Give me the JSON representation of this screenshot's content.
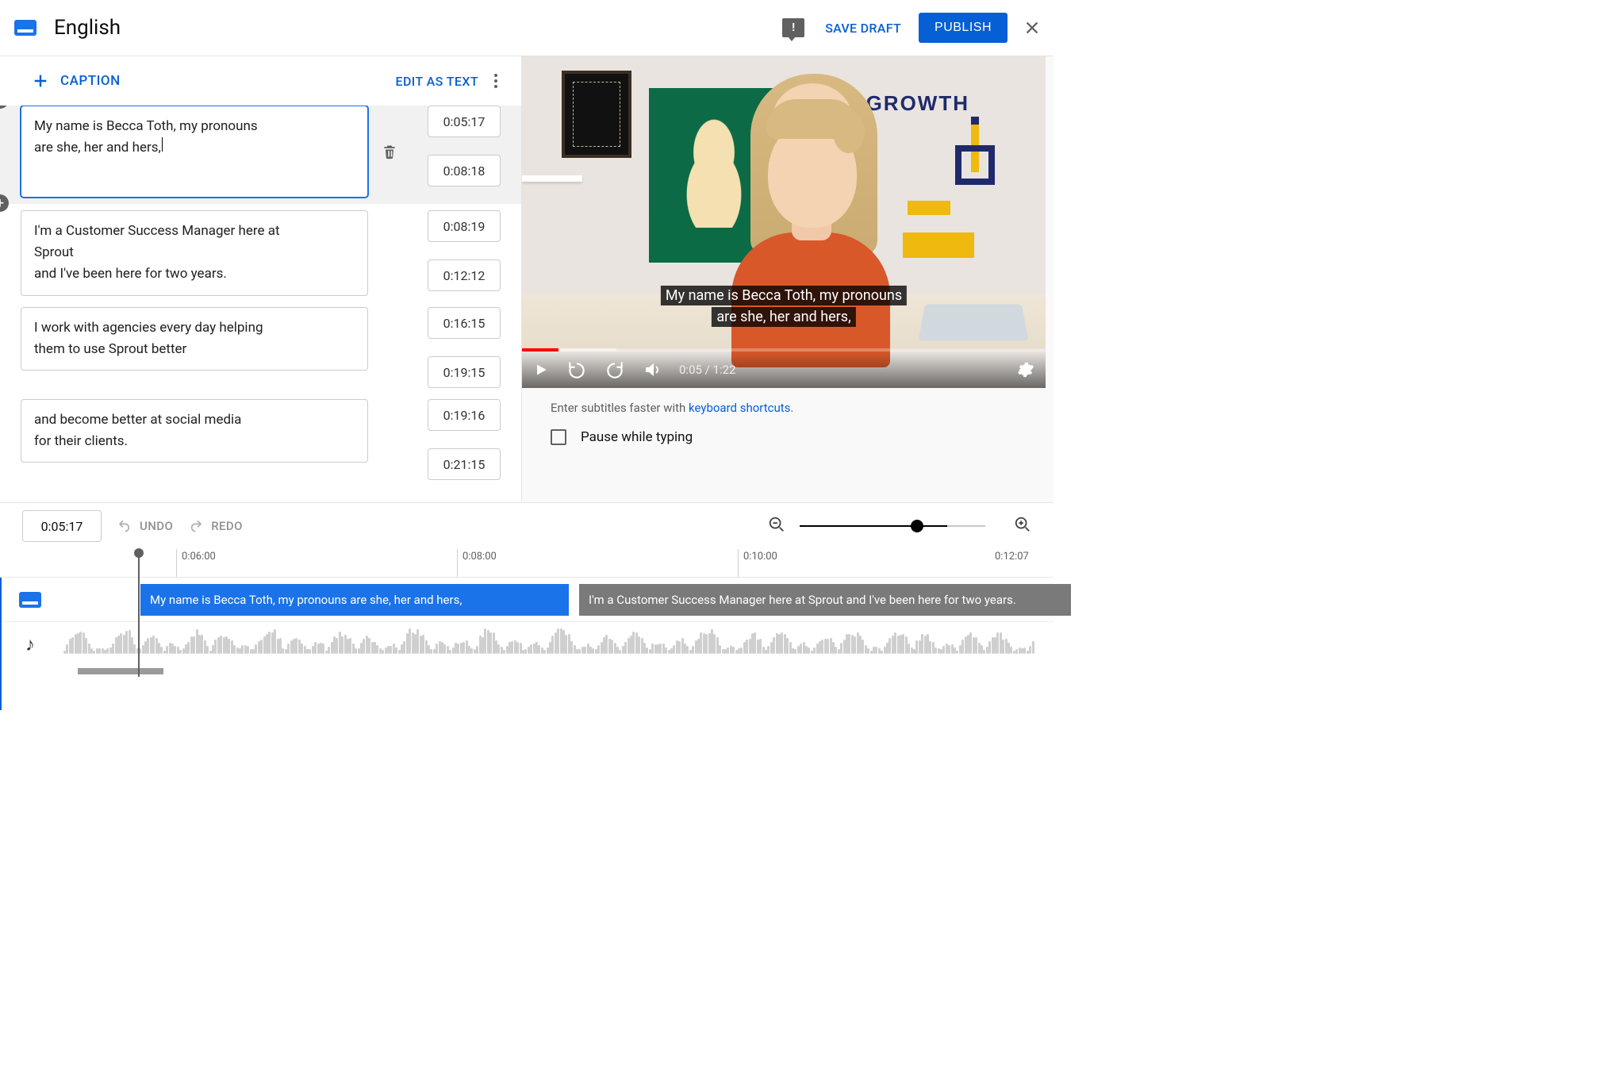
{
  "header": {
    "title": "English",
    "save_draft": "SAVE DRAFT",
    "publish": "PUBLISH"
  },
  "left": {
    "add_caption": "CAPTION",
    "edit_as_text": "EDIT AS TEXT"
  },
  "captions": [
    {
      "text_line1": "My name is Becca Toth, my pronouns",
      "text_line2": "are she, her and hers,",
      "start": "0:05:17",
      "end": "0:08:18",
      "active": true
    },
    {
      "text_line1": "I'm a Customer Success Manager here at",
      "text_line2": "Sprout",
      "text_line3": "and I've been here for two years.",
      "start": "0:08:19",
      "end": "0:12:12"
    },
    {
      "text_line1": "I work with agencies every day helping",
      "text_line2": "them to use Sprout better",
      "start": "0:16:15",
      "end": "0:19:15"
    },
    {
      "text_line1": "and become better at social media",
      "text_line2": "for their clients.",
      "start": "0:19:16",
      "end": "0:21:15"
    }
  ],
  "player": {
    "caption_line1": "My name is Becca Toth, my pronouns",
    "caption_line2": "are she, her and hers,",
    "time_label": "0:05 / 1:22",
    "wall_text": "GROWTH"
  },
  "hint": {
    "prefix": "Enter subtitles faster with ",
    "link": "keyboard shortcuts",
    "suffix": "."
  },
  "pause_label": "Pause while typing",
  "footer": {
    "current_time": "0:05:17",
    "undo": "UNDO",
    "redo": "REDO",
    "ticks": [
      "0:06:00",
      "0:08:00",
      "0:10:00",
      "0:12:07"
    ],
    "seg1": "My name is Becca Toth, my pronouns are she, her and hers,",
    "seg2": "I'm a Customer Success Manager here at Sprout and I've been here for two years."
  }
}
